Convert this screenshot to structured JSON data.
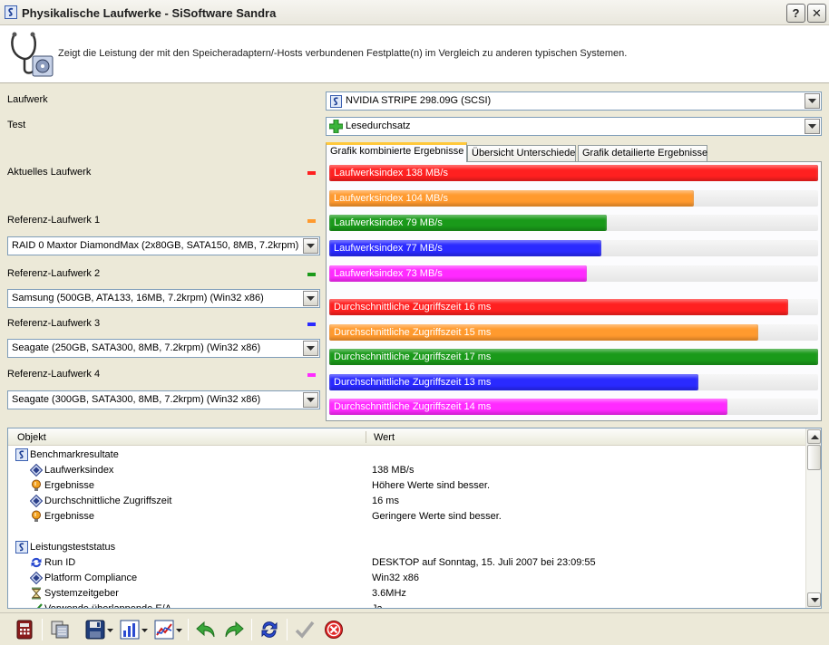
{
  "window": {
    "title": "Physikalische Laufwerke - SiSoftware Sandra",
    "help_label": "?",
    "close_label": "✕"
  },
  "banner": {
    "description": "Zeigt die Leistung der mit den Speicheradaptern/-Hosts verbundenen Festplatte(n) im Vergleich zu anderen typischen Systemen."
  },
  "form": {
    "drive_label": "Laufwerk",
    "drive_value": "NVIDIA  STRIPE  298.09G (SCSI)",
    "test_label": "Test",
    "test_value": "Lesedurchsatz",
    "current_label": "Aktuelles Laufwerk",
    "refs": [
      {
        "label": "Referenz-Laufwerk 1",
        "value": "RAID 0 Maxtor DiamondMax (2x80GB, SATA150, 8MB, 7.2krpm) (Win32 x86)",
        "color": "#ff9a2e"
      },
      {
        "label": "Referenz-Laufwerk 2",
        "value": "Samsung (500GB, ATA133, 16MB, 7.2krpm) (Win32 x86)",
        "color": "#1a9a1a"
      },
      {
        "label": "Referenz-Laufwerk 3",
        "value": "Seagate (250GB, SATA300, 8MB, 7.2krpm) (Win32 x86)",
        "color": "#2a2aff"
      },
      {
        "label": "Referenz-Laufwerk 4",
        "value": "Seagate (300GB, SATA300, 8MB, 7.2krpm) (Win32 x86)",
        "color": "#ff2aff"
      }
    ],
    "current_color": "#ff2020"
  },
  "tabs": [
    "Grafik kombinierte Ergebnisse",
    "Übersicht Unterschiede",
    "Grafik detailierte Ergebnisse"
  ],
  "chart_data": {
    "type": "bar",
    "groups": [
      {
        "metric": "Laufwerksindex",
        "unit": "MB/s",
        "series": [
          {
            "label": "Laufwerksindex 138 MB/s",
            "value": 138,
            "fraction": 1.0,
            "color": "#ff2020"
          },
          {
            "label": "Laufwerksindex 104 MB/s",
            "value": 104,
            "fraction": 0.746,
            "color": "#ff9a2e"
          },
          {
            "label": "Laufwerksindex 79 MB/s",
            "value": 79,
            "fraction": 0.568,
            "color": "#1a9a1a"
          },
          {
            "label": "Laufwerksindex 77 MB/s",
            "value": 77,
            "fraction": 0.557,
            "color": "#2a2aff"
          },
          {
            "label": "Laufwerksindex 73 MB/s",
            "value": 73,
            "fraction": 0.527,
            "color": "#ff2aff"
          }
        ]
      },
      {
        "metric": "Durchschnittliche Zugriffszeit",
        "unit": "ms",
        "series": [
          {
            "label": "Durchschnittliche Zugriffszeit 16 ms",
            "value": 16,
            "fraction": 0.938,
            "color": "#ff2020"
          },
          {
            "label": "Durchschnittliche Zugriffszeit 15 ms",
            "value": 15,
            "fraction": 0.877,
            "color": "#ff9a2e"
          },
          {
            "label": "Durchschnittliche Zugriffszeit 17 ms",
            "value": 17,
            "fraction": 1.0,
            "color": "#1a9a1a"
          },
          {
            "label": "Durchschnittliche Zugriffszeit 13 ms",
            "value": 13,
            "fraction": 0.755,
            "color": "#2a2aff"
          },
          {
            "label": "Durchschnittliche Zugriffszeit 14 ms",
            "value": 14,
            "fraction": 0.815,
            "color": "#ff2aff"
          }
        ]
      }
    ]
  },
  "results": {
    "col_object": "Objekt",
    "col_value": "Wert",
    "rows": [
      {
        "indent": 0,
        "icon": "sandra-icon",
        "object": "Benchmarkresultate",
        "value": ""
      },
      {
        "indent": 1,
        "icon": "diamond-icon",
        "object": "Laufwerksindex",
        "value": "138 MB/s"
      },
      {
        "indent": 1,
        "icon": "bulb-icon",
        "object": "Ergebnisse",
        "value": "Höhere Werte sind besser."
      },
      {
        "indent": 1,
        "icon": "diamond-icon",
        "object": "Durchschnittliche Zugriffszeit",
        "value": "16 ms"
      },
      {
        "indent": 1,
        "icon": "bulb-icon",
        "object": "Ergebnisse",
        "value": "Geringere Werte sind besser."
      },
      {
        "indent": 0,
        "icon": "none",
        "object": "",
        "value": ""
      },
      {
        "indent": 0,
        "icon": "sandra-icon",
        "object": "Leistungsteststatus",
        "value": ""
      },
      {
        "indent": 1,
        "icon": "refresh-icon",
        "object": "Run ID",
        "value": "DESKTOP auf Sonntag, 15. Juli 2007 bei 23:09:55"
      },
      {
        "indent": 1,
        "icon": "diamond-icon",
        "object": "Platform Compliance",
        "value": "Win32 x86"
      },
      {
        "indent": 1,
        "icon": "hourglass-icon",
        "object": "Systemzeitgeber",
        "value": "3.6MHz"
      },
      {
        "indent": 1,
        "icon": "check-icon",
        "object": "Verwende überlappende E/A",
        "value": "Ja"
      }
    ]
  },
  "toolbar": {
    "icons": [
      "calculator-icon",
      "copy-icon",
      "save-icon",
      "chart-icon",
      "graph-icon",
      "back-icon",
      "forward-icon",
      "refresh-icon",
      "ok-icon",
      "cancel-icon"
    ]
  }
}
